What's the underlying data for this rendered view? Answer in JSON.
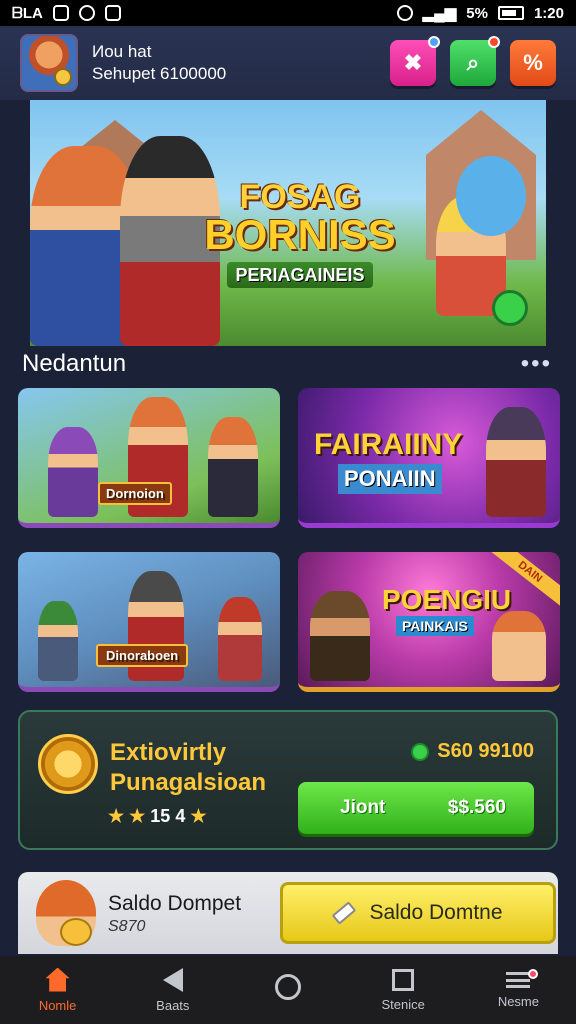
{
  "status_bar": {
    "left_text": "ᗷLA",
    "time": "1:20",
    "signal_text": "5%"
  },
  "header": {
    "profile_line1": "Иou hat",
    "profile_line2": "Sehupet 6100000",
    "buttons": [
      {
        "name": "pink-button",
        "glyph": "✖"
      },
      {
        "name": "green-button",
        "glyph": "⌕"
      },
      {
        "name": "orange-button",
        "glyph": "%"
      }
    ]
  },
  "banner": {
    "line1": "FOSAG",
    "line2": "BORNISS",
    "line3": "PERIAGAINEIS"
  },
  "section": {
    "title": "Nedantun",
    "more": "•••"
  },
  "cards": [
    {
      "label": "Dornoion"
    },
    {
      "label1": "FAIRAIINY",
      "label2": "PONAIIN"
    },
    {
      "label": "Dinoraboen"
    },
    {
      "label1": "POENGIU",
      "label2": "PAINKAIS",
      "ribbon": "DAIN"
    }
  ],
  "promo": {
    "title_line1": "Extiovirtly",
    "title_line2": "Punagalsioan",
    "stars": "★ ★",
    "rating": "15 4",
    "star_end": "★",
    "balance": "S60 99100",
    "cta_left": "Jiont",
    "cta_right": "$$.560"
  },
  "wallet": {
    "title": "Saldo Dompet",
    "amount": "S870",
    "button": "Saldo Domtne"
  },
  "nav": [
    {
      "label": "Nomle",
      "active": true
    },
    {
      "label": "Baats"
    },
    {
      "label": ""
    },
    {
      "label": "Stenice"
    },
    {
      "label": "Nesme"
    }
  ],
  "colors": {
    "accent": "#ff6a2a",
    "gold": "#ffc83a",
    "green": "#30b01a",
    "bg": "#1b2238"
  }
}
